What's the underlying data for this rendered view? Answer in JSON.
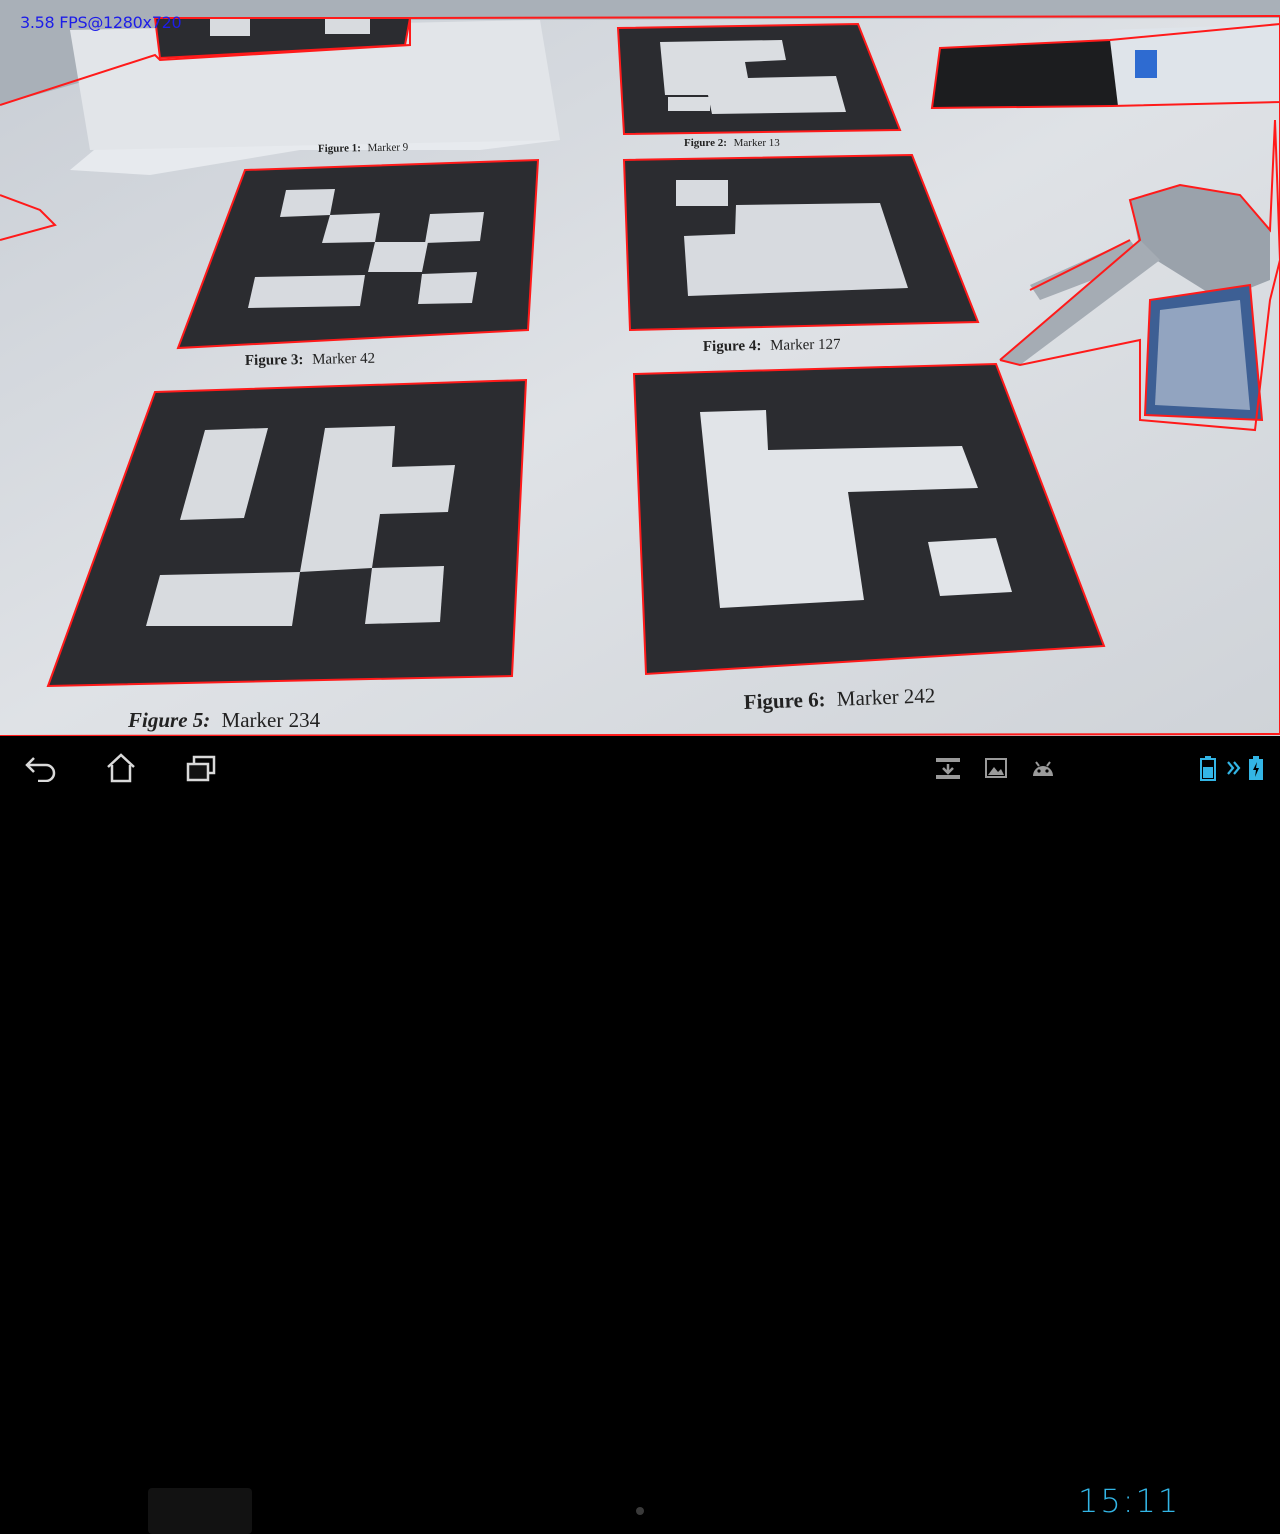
{
  "camera_overlay": {
    "fps_label": "3.58 FPS@1280x720"
  },
  "markers": [
    {
      "figure_label": "Figure 1:",
      "marker_label": "Marker 9"
    },
    {
      "figure_label": "Figure 2:",
      "marker_label": "Marker 13"
    },
    {
      "figure_label": "Figure 3:",
      "marker_label": "Marker 42"
    },
    {
      "figure_label": "Figure 4:",
      "marker_label": "Marker 127"
    },
    {
      "figure_label": "Figure 5:",
      "marker_label": "Marker 234"
    },
    {
      "figure_label": "Figure 6:",
      "marker_label": "Marker 242"
    }
  ],
  "status_bar": {
    "clock": "15:11"
  },
  "colors": {
    "contour": "#ff1a1a",
    "clock": "#33b5e5",
    "fps_text": "#1d1de8"
  },
  "icons": {
    "back": "back-icon",
    "home": "home-icon",
    "recent": "recent-apps-icon",
    "download": "download-notification-icon",
    "screenshot": "image-notification-icon",
    "debug": "android-debug-icon",
    "battery": "battery-charging-icon",
    "signal": "sync-icon"
  }
}
